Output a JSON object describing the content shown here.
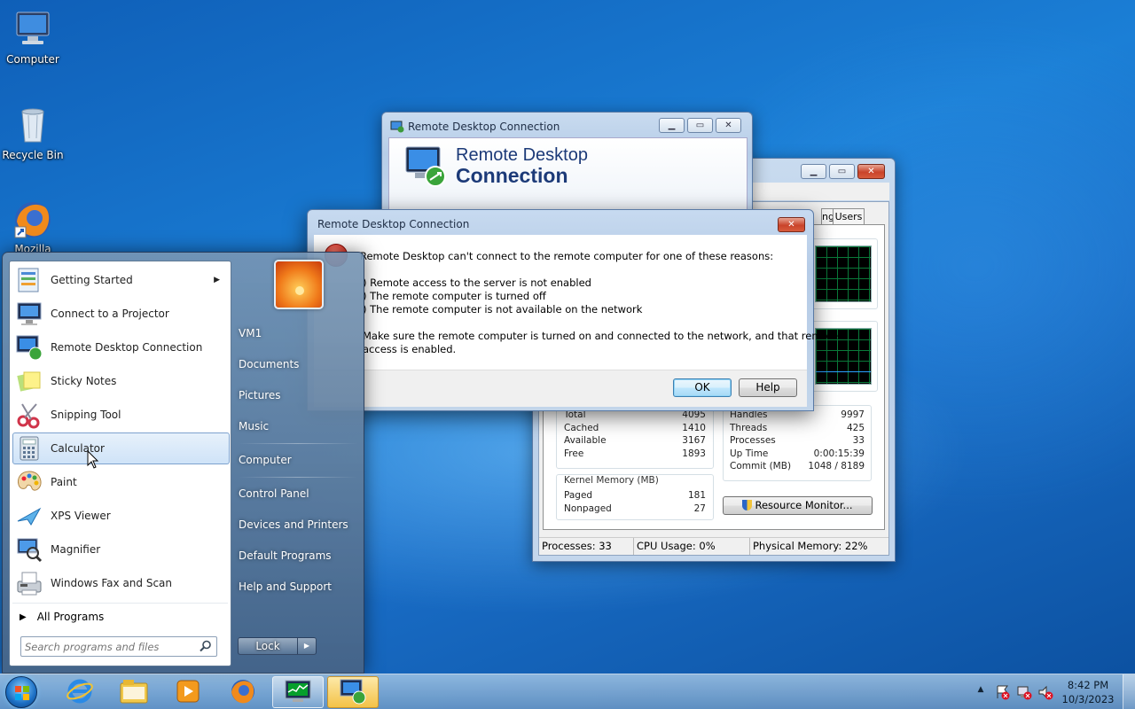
{
  "desktop": {
    "icons": [
      {
        "label": "Computer",
        "icon": "computer-icon"
      },
      {
        "label": "Recycle Bin",
        "icon": "recycle-bin-icon"
      },
      {
        "label": "Mozilla",
        "icon": "firefox-icon"
      }
    ]
  },
  "task_manager": {
    "tab_partial": "ng",
    "tab_users": "Users",
    "physical_memory": {
      "rows": [
        {
          "label": "Total",
          "value": "4095"
        },
        {
          "label": "Cached",
          "value": "1410"
        },
        {
          "label": "Available",
          "value": "3167"
        },
        {
          "label": "Free",
          "value": "1893"
        }
      ]
    },
    "kernel_memory": {
      "title": "Kernel Memory (MB)",
      "rows": [
        {
          "label": "Paged",
          "value": "181"
        },
        {
          "label": "Nonpaged",
          "value": "27"
        }
      ]
    },
    "system": {
      "rows": [
        {
          "label": "Handles",
          "value": "9997"
        },
        {
          "label": "Threads",
          "value": "425"
        },
        {
          "label": "Processes",
          "value": "33"
        },
        {
          "label": "Up Time",
          "value": "0:00:15:39"
        },
        {
          "label": "Commit (MB)",
          "value": "1048 / 8189"
        }
      ]
    },
    "resource_monitor_label": "Resource Monitor...",
    "status": {
      "processes": "Processes: 33",
      "cpu": "CPU Usage: 0%",
      "memory": "Physical Memory: 22%"
    }
  },
  "rdc_window": {
    "title": "Remote Desktop Connection",
    "banner_line1": "Remote Desktop",
    "banner_line2": "Connection"
  },
  "error_dialog": {
    "title": "Remote Desktop Connection",
    "intro": "Remote Desktop can't connect to the remote computer for one of these reasons:",
    "reasons": [
      ") Remote access to the server is not enabled",
      ") The remote computer is turned off",
      ") The remote computer is not available on the network"
    ],
    "advice_line1": "Make sure the remote computer is turned on and connected to the network, and that remote",
    "advice_line2": "access is enabled.",
    "ok_label": "OK",
    "help_label": "Help"
  },
  "start_menu": {
    "programs": [
      {
        "label": "Getting Started",
        "icon": "getting-started-icon",
        "has_submenu": true
      },
      {
        "label": "Connect to a Projector",
        "icon": "projector-icon"
      },
      {
        "label": "Remote Desktop Connection",
        "icon": "remote-desktop-icon"
      },
      {
        "label": "Sticky Notes",
        "icon": "sticky-notes-icon"
      },
      {
        "label": "Snipping Tool",
        "icon": "scissors-icon"
      },
      {
        "label": "Calculator",
        "icon": "calculator-icon",
        "highlighted": true
      },
      {
        "label": "Paint",
        "icon": "paint-palette-icon"
      },
      {
        "label": "XPS Viewer",
        "icon": "xps-viewer-icon"
      },
      {
        "label": "Magnifier",
        "icon": "magnifier-icon"
      },
      {
        "label": "Windows Fax and Scan",
        "icon": "fax-icon"
      }
    ],
    "all_programs": "All Programs",
    "search_placeholder": "Search programs and files",
    "right_items": {
      "user": "VM1",
      "documents": "Documents",
      "pictures": "Pictures",
      "music": "Music",
      "computer": "Computer",
      "control_panel": "Control Panel",
      "devices": "Devices and Printers",
      "default_programs": "Default Programs",
      "help": "Help and Support"
    },
    "lock_label": "Lock"
  },
  "taskbar": {
    "clock_time": "8:42 PM",
    "clock_date": "10/3/2023"
  }
}
